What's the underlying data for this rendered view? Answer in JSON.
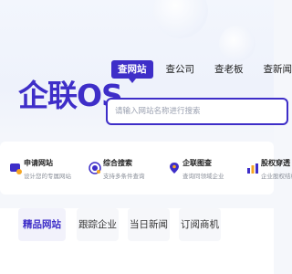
{
  "brand": {
    "logo": "企联OS"
  },
  "search": {
    "tabs": [
      "查网站",
      "查公司",
      "查老板",
      "查新闻"
    ],
    "active_tab": 0,
    "placeholder": "请输入网站名称进行搜索"
  },
  "features": [
    {
      "title": "申请网站",
      "desc": "设计您的专属网站",
      "icon": "site-apply-icon"
    },
    {
      "title": "综合搜索",
      "desc": "支持多条件查询",
      "icon": "search-target-icon"
    },
    {
      "title": "企联图查",
      "desc": "查询同领域企业",
      "icon": "map-pin-icon"
    },
    {
      "title": "股权穿透",
      "desc": "企业股权结构",
      "icon": "bar-chart-icon"
    }
  ],
  "bottom_tabs": [
    "精品网站",
    "跟踪企业",
    "当日新闻",
    "订阅商机"
  ],
  "colors": {
    "accent": "#3e2ec8",
    "orange": "#f5a623"
  }
}
